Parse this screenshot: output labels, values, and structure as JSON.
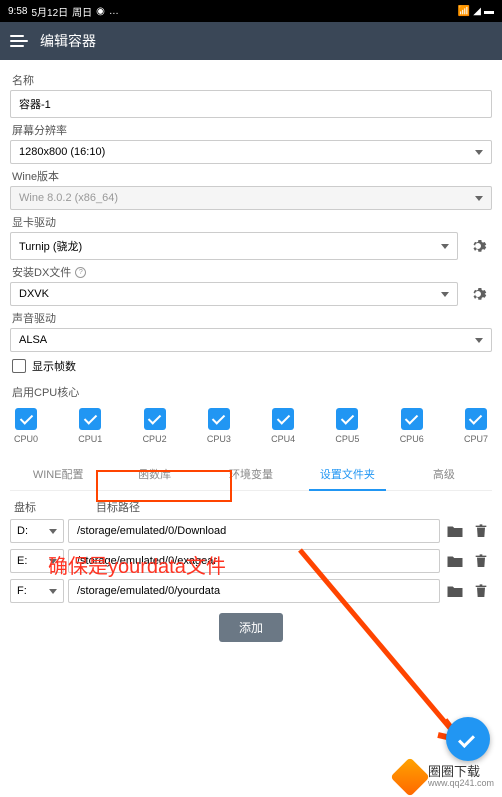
{
  "status": {
    "time": "9:58",
    "date": "5月12日",
    "day": "周日"
  },
  "header": {
    "title": "编辑容器"
  },
  "fields": {
    "name_label": "名称",
    "name_value": "容器-1",
    "resolution_label": "屏幕分辨率",
    "resolution_value": "1280x800 (16:10)",
    "wine_label": "Wine版本",
    "wine_value": "Wine 8.0.2 (x86_64)",
    "gpu_label": "显卡驱动",
    "gpu_value": "Turnip (骁龙)",
    "dx_label": "安装DX文件",
    "dx_value": "DXVK",
    "audio_label": "声音驱动",
    "audio_value": "ALSA",
    "fps_label": "显示帧数",
    "cpu_label": "启用CPU核心"
  },
  "cpus": [
    "CPU0",
    "CPU1",
    "CPU2",
    "CPU3",
    "CPU4",
    "CPU5",
    "CPU6",
    "CPU7"
  ],
  "tabs": {
    "wine": "WINE配置",
    "registry": "函数库",
    "envvars": "环境变量",
    "folders": "设置文件夹",
    "advanced": "高级"
  },
  "drives": {
    "letter_label": "盘标",
    "path_label": "目标路径",
    "rows": [
      {
        "letter": "D:",
        "path": "/storage/emulated/0/Download"
      },
      {
        "letter": "E:",
        "path": "/storage/emulated/0/exagear"
      },
      {
        "letter": "F:",
        "path": "/storage/emulated/0/yourdata"
      }
    ]
  },
  "add_button": "添加",
  "annotation": "确保是yourdata文件",
  "watermark": {
    "name": "圈圈下载",
    "url": "www.qq241.com"
  }
}
